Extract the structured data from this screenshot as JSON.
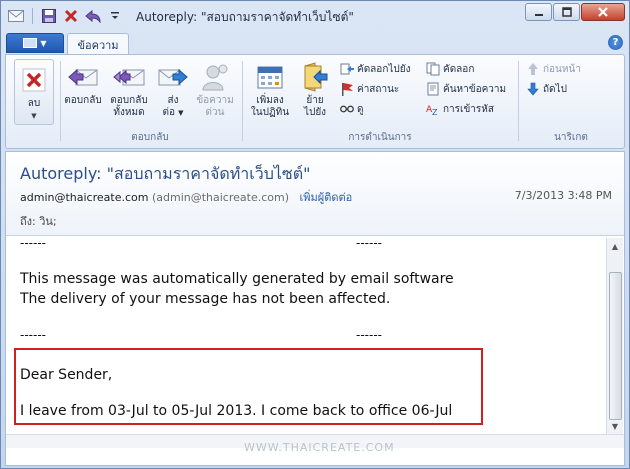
{
  "window": {
    "title": "Autoreply: \"สอบถามราคาจัดทำเว็บไซต์\"",
    "controls": {
      "minimize": "▭",
      "maximize": "□",
      "close": "✕"
    }
  },
  "quick_access": {
    "icons": [
      "mail-icon",
      "save-icon",
      "delete-icon",
      "reply-icon",
      "dropdown-icon"
    ]
  },
  "tabs": {
    "file_icon": "file-menu-icon",
    "active_tab": "ข้อความ"
  },
  "ribbon": {
    "delete": {
      "label": "ลบ"
    },
    "respond": {
      "reply": "ตอบกลับ",
      "reply_all_line1": "ตอบกลับ",
      "reply_all_line2": "ทั้งหมด",
      "forward_line1": "ส่ง",
      "forward_line2": "ต่อ",
      "im_line1": "ข้อความ",
      "im_line2": "ด่วน",
      "group_label": "ตอบกลับ"
    },
    "actions": {
      "calendar_line1": "เพิ่มลง",
      "calendar_line2": "ในปฏิทิน",
      "move_line1": "ย้าย",
      "move_line2": "ไปยัง",
      "copy_to": "คัดลอกไปยัง",
      "status": "ค่าสถานะ",
      "view": "ดู",
      "copy": "คัดลอก",
      "find": "ค้นหาข้อความ",
      "encrypt": "การเข้ารหัส",
      "group_label": "การดำเนินการ"
    },
    "navigate": {
      "previous": "ก่อนหน้า",
      "next": "ถัดไป",
      "group_label": "นาริเกต"
    }
  },
  "message": {
    "subject": "Autoreply: \"สอบถามราคาจัดทำเว็บไซต์\"",
    "from_email": "admin@thaicreate.com",
    "from_addr": "(admin@thaicreate.com)",
    "add_contact": "เพิ่มผู้ติดต่อ",
    "date": "7/3/2013 3:48 PM",
    "to": "ถึง: วิน;",
    "body": {
      "dash_left_1": "------",
      "dash_right_1": "------",
      "line1": "This message was automatically generated by email software",
      "line2": "The delivery of your message has not been affected.",
      "dash_left_2": "------",
      "dash_right_2": "------",
      "greeting": "Dear Sender,",
      "leave": "I leave from 03-Jul to 05-Jul 2013. I come back to office 06-Jul"
    }
  },
  "watermark": "WWW.THAICREATE.COM",
  "colors": {
    "accent": "#2a4f88",
    "highlight_box": "#d02020",
    "link": "#2a5db0"
  }
}
